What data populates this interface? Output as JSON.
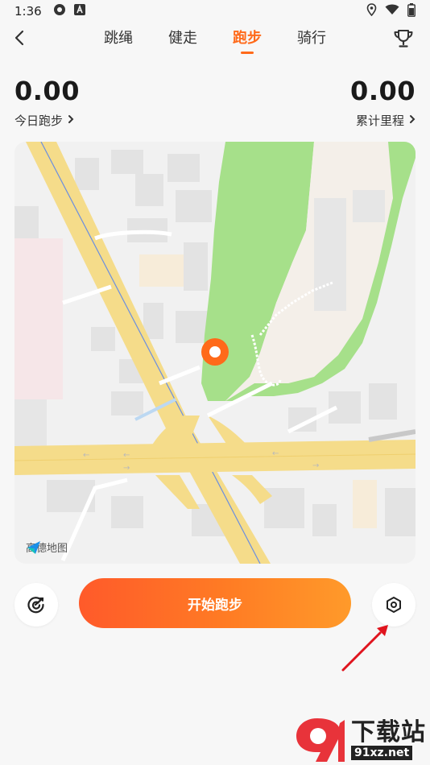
{
  "status_bar": {
    "time": "1:36"
  },
  "nav": {
    "tabs": [
      {
        "label": "跳绳",
        "active": false
      },
      {
        "label": "健走",
        "active": false
      },
      {
        "label": "跑步",
        "active": true
      },
      {
        "label": "骑行",
        "active": false
      }
    ]
  },
  "stats": {
    "today": {
      "value": "0.00",
      "label": "今日跑步"
    },
    "total": {
      "value": "0.00",
      "label": "累计里程"
    }
  },
  "map": {
    "provider_label": "高德地图"
  },
  "controls": {
    "start_label": "开始跑步"
  },
  "watermark": {
    "text": "下载站",
    "url": "91xz.net"
  },
  "colors": {
    "accent": "#ff6a1a",
    "park": "#a6e08a",
    "road": "#f5dc8a",
    "annotation": "#e0141e"
  }
}
